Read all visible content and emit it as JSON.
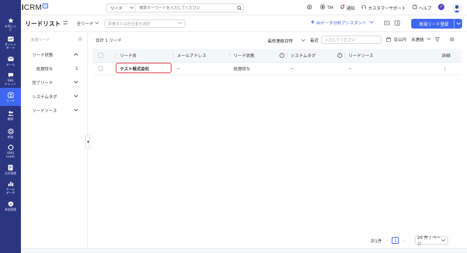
{
  "brand": {
    "name_bold": "OKKI",
    "name_light": "CRM",
    "badge": "AI"
  },
  "search": {
    "scope": "リード",
    "placeholder": "検索キーワードを入力してください"
  },
  "topbar": {
    "tm_label": "TM",
    "notify_label": "通知",
    "support_label": "カスタマーサポート",
    "help_label": "ヘルプ"
  },
  "leftnav": {
    "items": [
      {
        "icon": "star-icon",
        "label": "お気に入\nり"
      },
      {
        "icon": "dashboard-icon",
        "label": "ダッシュ\nボード"
      },
      {
        "icon": "mail-icon",
        "label": "メール"
      },
      {
        "icon": "chat-icon",
        "label": "SNS\nチャット"
      },
      {
        "icon": "leads-icon",
        "label": "リード"
      },
      {
        "icon": "customer-icon",
        "label": "顧客"
      },
      {
        "icon": "deal-icon",
        "label": "商談"
      },
      {
        "icon": "okki-leads-icon",
        "label": "OKKI\nLeads"
      },
      {
        "icon": "order-icon",
        "label": "注文管理"
      },
      {
        "icon": "team-icon",
        "label": "チーム\nデータ"
      },
      {
        "icon": "approval-icon",
        "label": "承認管理"
      }
    ]
  },
  "pagehead": {
    "title": "リードリスト",
    "scope_select": "全リード",
    "assignee_placeholder": "部署または担当者を選択",
    "ai_assistant": "AIデータ分析アシスタント",
    "new_button": "新規リード登録"
  },
  "filterpanel": {
    "top_label": "未読リード",
    "groups": [
      {
        "label": "リード状態",
        "expanded": true
      },
      {
        "label": "処理待ち",
        "count": "1",
        "sub": true
      },
      {
        "label": "完了リード"
      },
      {
        "label": "システムタグ"
      },
      {
        "label": "リードソース"
      }
    ]
  },
  "toolbar": {
    "count_text": "合計 1 リード",
    "sort_label": "最終連絡日時",
    "recent_label": "最近",
    "recent_placeholder": "入力してください",
    "days_label": "日以内",
    "status_select": "未連絡"
  },
  "table": {
    "headers": {
      "name": "リード名",
      "email": "メールアドレス",
      "status": "リード状態",
      "tag": "システムタグ",
      "source": "リードソース",
      "detail": "詳細"
    },
    "rows": [
      {
        "name": "テスト株式会社",
        "email": "--",
        "status": "処理待ち",
        "tag": "--",
        "source": "--"
      }
    ]
  },
  "pager": {
    "total": "計1件",
    "current_page": "1",
    "page_size": "20 件 / ページ"
  },
  "colors": {
    "nav_bg": "#2b3580",
    "accent": "#3f67ef",
    "highlight": "#e0393e"
  }
}
